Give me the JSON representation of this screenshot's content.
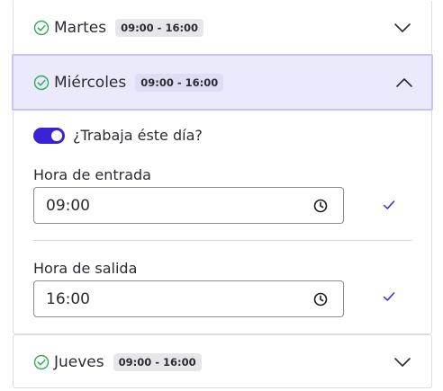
{
  "colors": {
    "accent": "#3a22d6",
    "success": "#2eaa5a",
    "active_header_bg": "#ebe9fc",
    "active_header_border": "#c7c3f3"
  },
  "days": {
    "martes": {
      "label": "Martes",
      "hours": "09:00 - 16:00",
      "status_icon": "check-circle-icon",
      "expanded": false
    },
    "miercoles": {
      "label": "Miércoles",
      "hours": "09:00 - 16:00",
      "status_icon": "check-circle-icon",
      "expanded": true,
      "works_toggle_label": "¿Trabaja éste día?",
      "works_toggle_on": true,
      "entry_label": "Hora de entrada",
      "entry_value": "09:00",
      "exit_label": "Hora de salida",
      "exit_value": "16:00"
    },
    "jueves": {
      "label": "Jueves",
      "hours": "09:00 - 16:00",
      "status_icon": "check-circle-icon",
      "expanded": false
    }
  }
}
